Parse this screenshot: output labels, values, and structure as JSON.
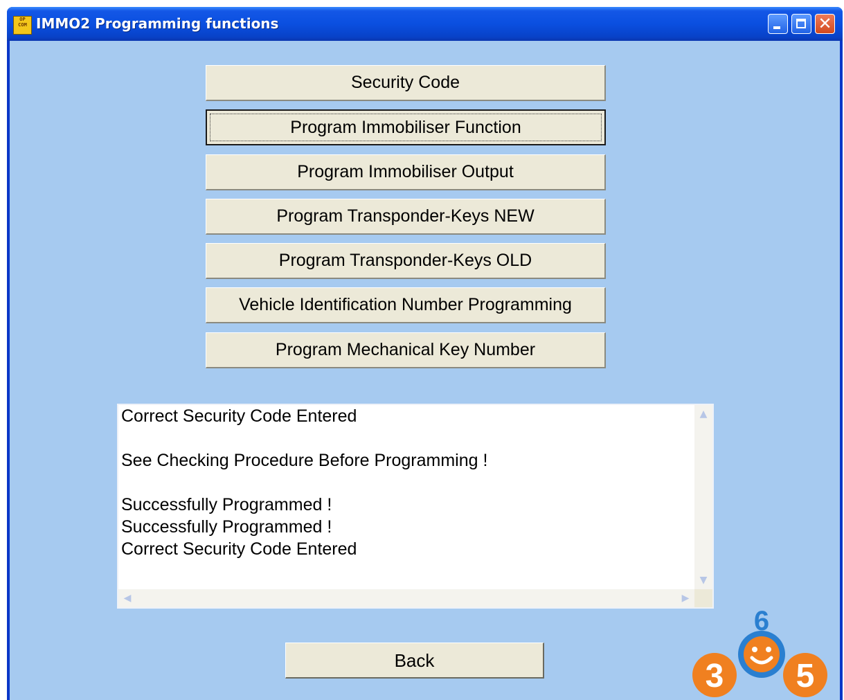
{
  "window": {
    "title": "IMMO2 Programming functions",
    "app_icon_lines": [
      "OP",
      "COM"
    ]
  },
  "function_buttons": [
    {
      "label": "Security Code"
    },
    {
      "label": "Program Immobiliser Function",
      "focused": true
    },
    {
      "label": "Program Immobiliser Output"
    },
    {
      "label": "Program Transponder-Keys NEW"
    },
    {
      "label": "Program Transponder-Keys OLD"
    },
    {
      "label": "Vehicle Identification Number Programming"
    },
    {
      "label": "Program Mechanical Key Number"
    }
  ],
  "log": {
    "text": "Correct Security Code Entered\n\nSee Checking Procedure Before Programming !\n\nSuccessfully Programmed !\nSuccessfully Programmed !\nCorrect Security Code Entered"
  },
  "back_label": "Back",
  "watermark": {
    "digits": [
      "3",
      "6",
      "5"
    ]
  },
  "colors": {
    "titlebar": "#0a4fe0",
    "client_bg": "#a6caf0",
    "button_face": "#ece9d8",
    "watermark_orange": "#f08020",
    "watermark_blue": "#2a7fd0"
  }
}
